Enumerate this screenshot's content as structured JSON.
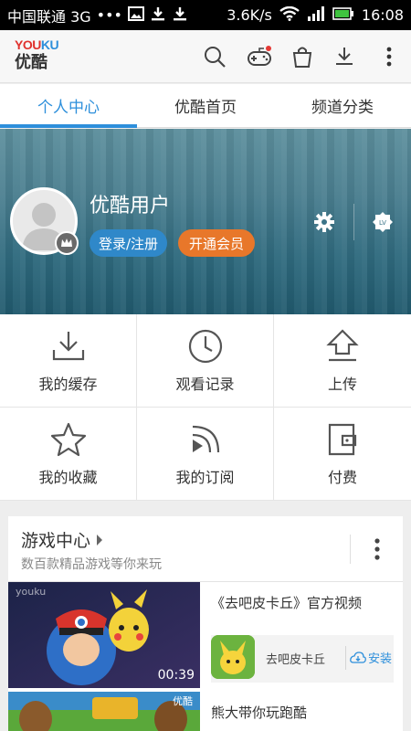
{
  "statusbar": {
    "carrier": "中国联通 3G",
    "dots": "•••",
    "speed": "3.6K/s",
    "time": "16:08"
  },
  "header": {
    "logo_en_you": "YOU",
    "logo_en_ku": "KU",
    "logo_cn": "优酷",
    "icons": [
      "search-icon",
      "gamepad-icon",
      "shopping-bag-icon",
      "download-icon",
      "more-vertical-icon"
    ]
  },
  "tabs": [
    {
      "label": "个人中心",
      "active": true
    },
    {
      "label": "优酷首页",
      "active": false
    },
    {
      "label": "频道分类",
      "active": false
    }
  ],
  "profile": {
    "username": "优酷用户",
    "login_label": "登录/注册",
    "vip_label": "开通会员",
    "lv_badge": "LV"
  },
  "grid": [
    {
      "label": "我的缓存",
      "icon": "download-tray-icon"
    },
    {
      "label": "观看记录",
      "icon": "clock-icon"
    },
    {
      "label": "上传",
      "icon": "upload-icon"
    },
    {
      "label": "我的收藏",
      "icon": "star-icon"
    },
    {
      "label": "我的订阅",
      "icon": "subscribe-rss-icon"
    },
    {
      "label": "付费",
      "icon": "wallet-icon"
    }
  ],
  "game_center": {
    "title": "游戏中心",
    "subtitle": "数百款精品游戏等你来玩",
    "items": [
      {
        "title": "《去吧皮卡丘》官方视频",
        "duration": "00:39",
        "watermark": "youku",
        "app_name": "去吧皮卡丘",
        "install_label": "安装"
      },
      {
        "title": "熊大带你玩跑酷",
        "watermark": "优酷"
      }
    ]
  }
}
